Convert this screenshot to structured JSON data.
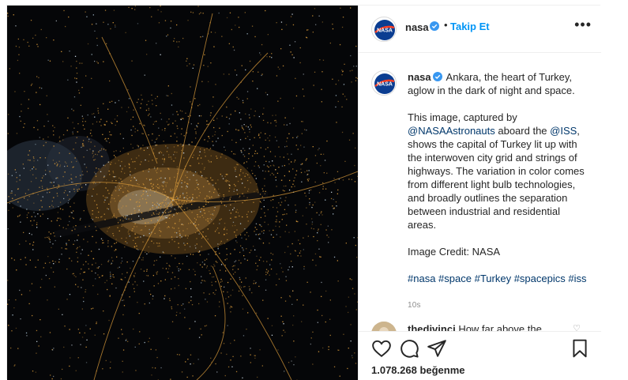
{
  "post": {
    "image_alt": "Ankara at night from ISS",
    "account": {
      "username": "nasa",
      "separator": "•",
      "follow_label": "Takip Et",
      "more_label": "•••"
    },
    "caption": {
      "username": "nasa",
      "line1": "Ankara, the heart of Turkey, aglow in the dark of night and space.",
      "p2_before": "This image, captured by ",
      "mention1": "@NASAAstronauts",
      "p2_mid": " aboard the ",
      "mention2": "@ISS",
      "p2_after": ", shows the capital of Turkey lit up with the interwoven city grid and strings of highways. The variation in color comes from different light bulb technologies, and broadly outlines the separation between industrial and residential areas.",
      "credit": "Image Credit: NASA",
      "hashtags": [
        "#nasa",
        "#space",
        "#Turkey",
        "#spacepics",
        "#iss"
      ],
      "time_ago": "10s"
    },
    "comment": {
      "username": "thedivinci",
      "text": "How far above the",
      "heart": "♡"
    },
    "likes": "1.078.268 beğenme"
  },
  "colors": {
    "accent": "#0095f6",
    "link": "#00376b",
    "verified": "#3897f0",
    "city_light": "#d89a3a"
  }
}
